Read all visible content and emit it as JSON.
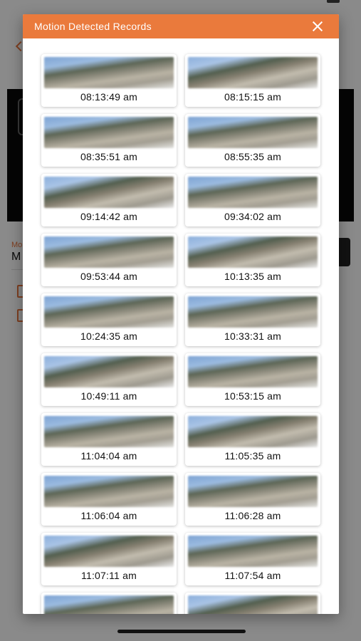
{
  "dialog": {
    "title": "Motion Detected Records",
    "close_icon": "close-icon"
  },
  "records": [
    {
      "time": "08:13:49 am"
    },
    {
      "time": "08:15:15 am"
    },
    {
      "time": "08:35:51 am"
    },
    {
      "time": "08:55:35 am"
    },
    {
      "time": "09:14:42 am"
    },
    {
      "time": "09:34:02 am"
    },
    {
      "time": "09:53:44 am"
    },
    {
      "time": "10:13:35 am"
    },
    {
      "time": "10:24:35 am"
    },
    {
      "time": "10:33:31 am"
    },
    {
      "time": "10:49:11 am"
    },
    {
      "time": "10:53:15 am"
    },
    {
      "time": "11:04:04 am"
    },
    {
      "time": "11:05:35 am"
    },
    {
      "time": "11:06:04 am"
    },
    {
      "time": "11:06:28 am"
    },
    {
      "time": "11:07:11 am"
    },
    {
      "time": "11:07:54 am"
    },
    {
      "time": ""
    },
    {
      "time": ""
    }
  ],
  "background": {
    "label_small": "Mo",
    "label_big": "M"
  },
  "colors": {
    "accent": "#ea7a3c",
    "dialog_bg": "#ffffff"
  }
}
